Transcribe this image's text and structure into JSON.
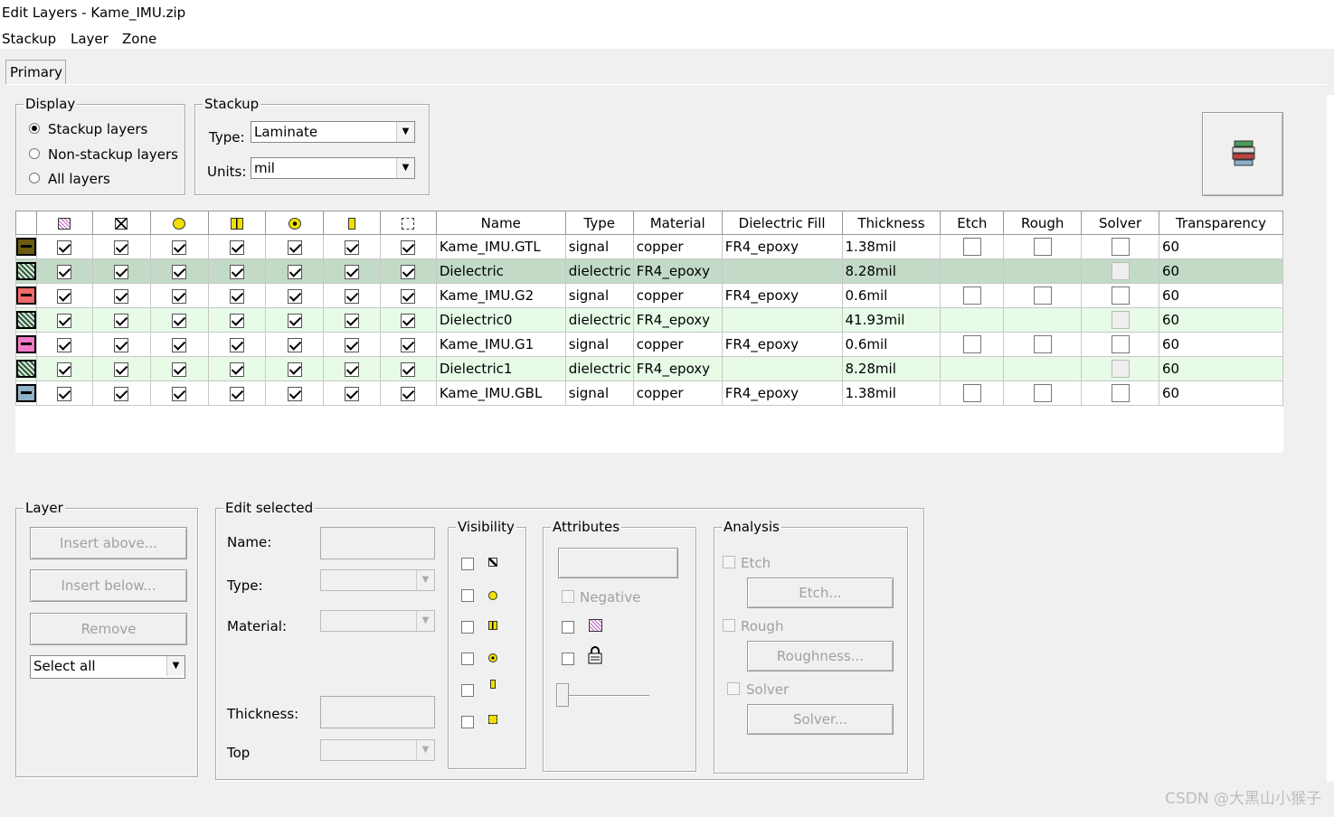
{
  "window": {
    "title": "Edit Layers - Kame_IMU.zip"
  },
  "menu": [
    "Stackup",
    "Layer",
    "Zone"
  ],
  "tabs": [
    {
      "label": "Primary"
    }
  ],
  "display": {
    "title": "Display",
    "options": [
      "Stackup layers",
      "Non-stackup layers",
      "All layers"
    ],
    "selected": "Stackup layers"
  },
  "stackup": {
    "title": "Stackup",
    "type_label": "Type:",
    "type_value": "Laminate",
    "units_label": "Units:",
    "units_value": "mil"
  },
  "table": {
    "icon_columns": [
      "fill-icon",
      "cross-box-icon",
      "via-icon",
      "pad-icon",
      "target-icon",
      "pin-icon",
      "component-icon"
    ],
    "columns": [
      "Name",
      "Type",
      "Material",
      "Dielectric Fill",
      "Thickness",
      "Etch",
      "Rough",
      "Solver",
      "Transparency"
    ],
    "rows": [
      {
        "color": "#6b5a10",
        "kind": "signal",
        "name": "Kame_IMU.GTL",
        "type": "signal",
        "material": "copper",
        "fill": "FR4_epoxy",
        "thickness": "1.38mil",
        "transparency": "60"
      },
      {
        "color": "#2e5e3a",
        "kind": "dielectric-selected",
        "name": "Dielectric",
        "type": "dielectric",
        "material": "FR4_epoxy",
        "fill": "",
        "thickness": "8.28mil",
        "transparency": "60"
      },
      {
        "color": "#f06a6a",
        "kind": "signal",
        "name": "Kame_IMU.G2",
        "type": "signal",
        "material": "copper",
        "fill": "FR4_epoxy",
        "thickness": "0.6mil",
        "transparency": "60"
      },
      {
        "color": "#2e5e3a",
        "kind": "dielectric",
        "name": "Dielectric0",
        "type": "dielectric",
        "material": "FR4_epoxy",
        "fill": "",
        "thickness": "41.93mil",
        "transparency": "60"
      },
      {
        "color": "#f27ac6",
        "kind": "signal",
        "name": "Kame_IMU.G1",
        "type": "signal",
        "material": "copper",
        "fill": "FR4_epoxy",
        "thickness": "0.6mil",
        "transparency": "60"
      },
      {
        "color": "#2e5e3a",
        "kind": "dielectric",
        "name": "Dielectric1",
        "type": "dielectric",
        "material": "FR4_epoxy",
        "fill": "",
        "thickness": "8.28mil",
        "transparency": "60"
      },
      {
        "color": "#8fb2c9",
        "kind": "signal",
        "name": "Kame_IMU.GBL",
        "type": "signal",
        "material": "copper",
        "fill": "FR4_epoxy",
        "thickness": "1.38mil",
        "transparency": "60"
      }
    ]
  },
  "layer_group": {
    "title": "Layer",
    "insert_above": "Insert above...",
    "insert_below": "Insert below...",
    "remove": "Remove",
    "select_value": "Select all"
  },
  "edit_selected": {
    "title": "Edit selected",
    "name_label": "Name:",
    "type_label": "Type:",
    "material_label": "Material:",
    "thickness_label": "Thickness:",
    "top_label": "Top"
  },
  "visibility": {
    "title": "Visibility"
  },
  "attributes": {
    "title": "Attributes",
    "negative_label": "Negative"
  },
  "analysis": {
    "title": "Analysis",
    "etch_label": "Etch",
    "etch_button": "Etch...",
    "rough_label": "Rough",
    "rough_button": "Roughness...",
    "solver_label": "Solver",
    "solver_button": "Solver..."
  },
  "watermark": "CSDN @大黑山小猴子"
}
